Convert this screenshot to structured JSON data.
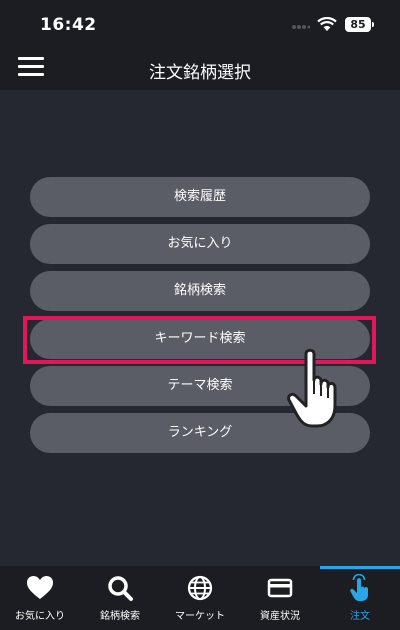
{
  "status_bar": {
    "time": "16:42",
    "battery": "85"
  },
  "header": {
    "title": "注文銘柄選択"
  },
  "menu": {
    "items": [
      {
        "label": "検索履歴"
      },
      {
        "label": "お気に入り"
      },
      {
        "label": "銘柄検索"
      },
      {
        "label": "キーワード検索"
      },
      {
        "label": "テーマ検索"
      },
      {
        "label": "ランキング"
      }
    ],
    "highlighted_item": "キーワード検索"
  },
  "tab_bar": {
    "tabs": [
      {
        "label": "お気に入り",
        "icon": "heart-icon"
      },
      {
        "label": "銘柄検索",
        "icon": "search-icon"
      },
      {
        "label": "マーケット",
        "icon": "globe-icon"
      },
      {
        "label": "資産状況",
        "icon": "card-icon"
      },
      {
        "label": "注文",
        "icon": "tap-hand-icon"
      }
    ],
    "active": "注文"
  },
  "colors": {
    "background": "#252830",
    "bar": "#1b1d22",
    "button": "#5a5c66",
    "highlight": "#e2165a",
    "accent": "#2aa5e6"
  }
}
